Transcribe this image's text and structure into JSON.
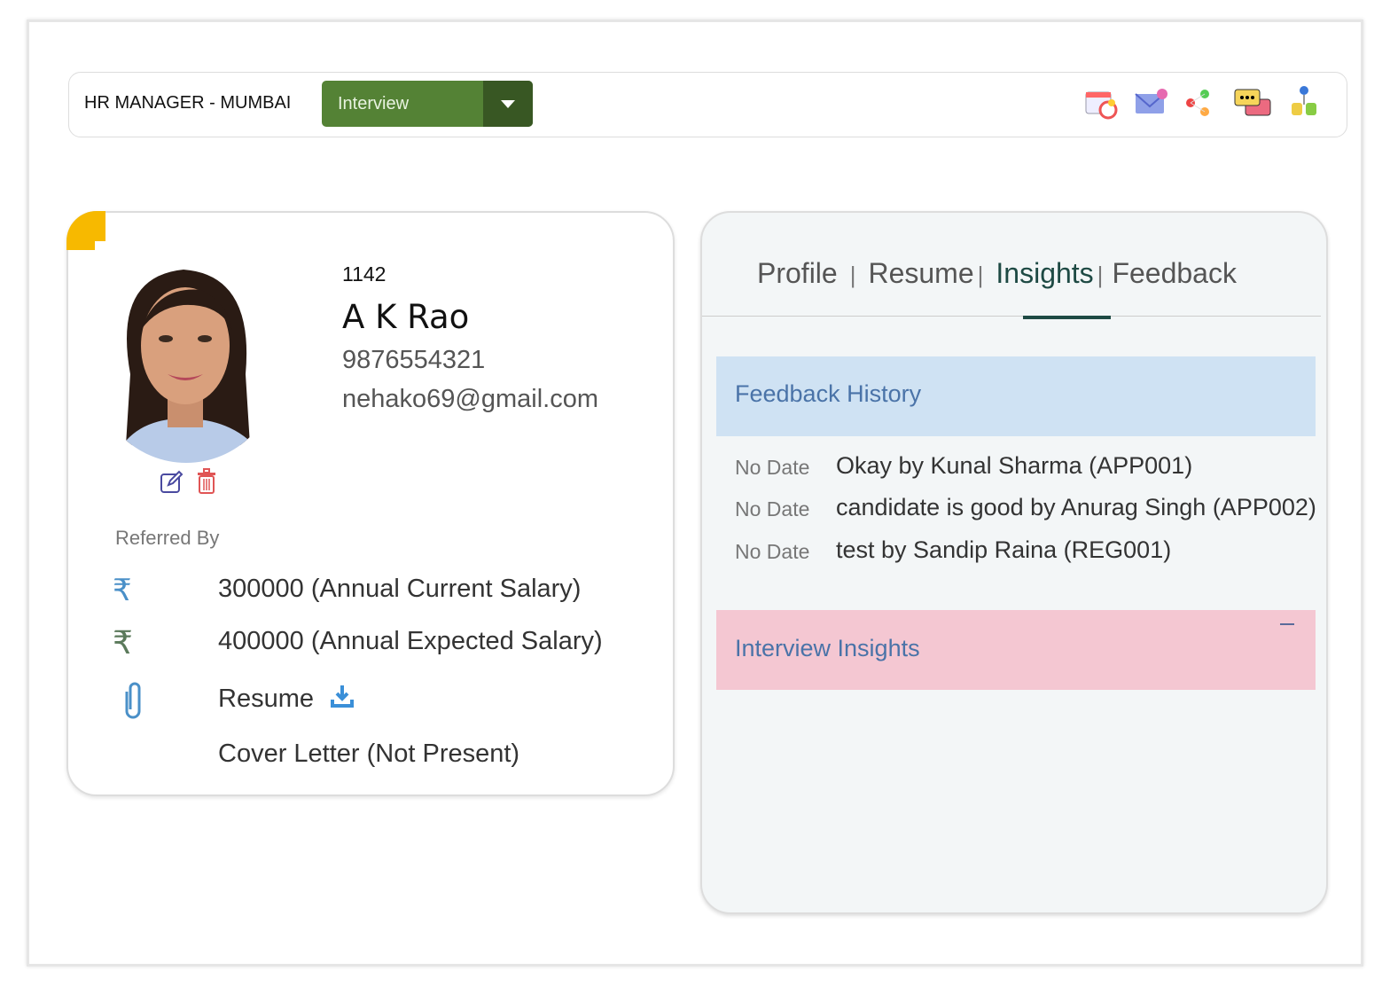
{
  "header": {
    "job_title": "HR MANAGER - MUMBAI",
    "stage": "Interview",
    "icons": [
      "calendar-schedule-icon",
      "email-icon",
      "share-icon",
      "chat-icon",
      "users-icon"
    ]
  },
  "candidate": {
    "id": "1142",
    "name": "A K Rao",
    "phone": "9876554321",
    "email": "nehako69@gmail.com",
    "referred_by_label": "Referred By",
    "current_salary": "300000 (Annual Current Salary)",
    "expected_salary": "400000 (Annual Expected Salary)",
    "resume_label": "Resume",
    "cover_letter": "Cover Letter (Not Present)"
  },
  "tabs": {
    "profile": "Profile",
    "resume": "Resume",
    "insights": "Insights",
    "feedback": "Feedback",
    "separator": "|"
  },
  "feedback_history": {
    "title": "Feedback History",
    "items": [
      {
        "date": "No Date",
        "text": "Okay by Kunal Sharma (APP001)"
      },
      {
        "date": "No Date",
        "text": "candidate is good by Anurag Singh (APP002)"
      },
      {
        "date": "No Date",
        "text": "test by Sandip Raina (REG001)"
      }
    ]
  },
  "interview_insights": {
    "title": "Interview Insights"
  },
  "colors": {
    "stage": "#548235",
    "accent": "#1e4a44",
    "feedback_bg": "#cfe2f3",
    "insights_bg": "#f4c7d2",
    "corner": "#f7b900"
  }
}
